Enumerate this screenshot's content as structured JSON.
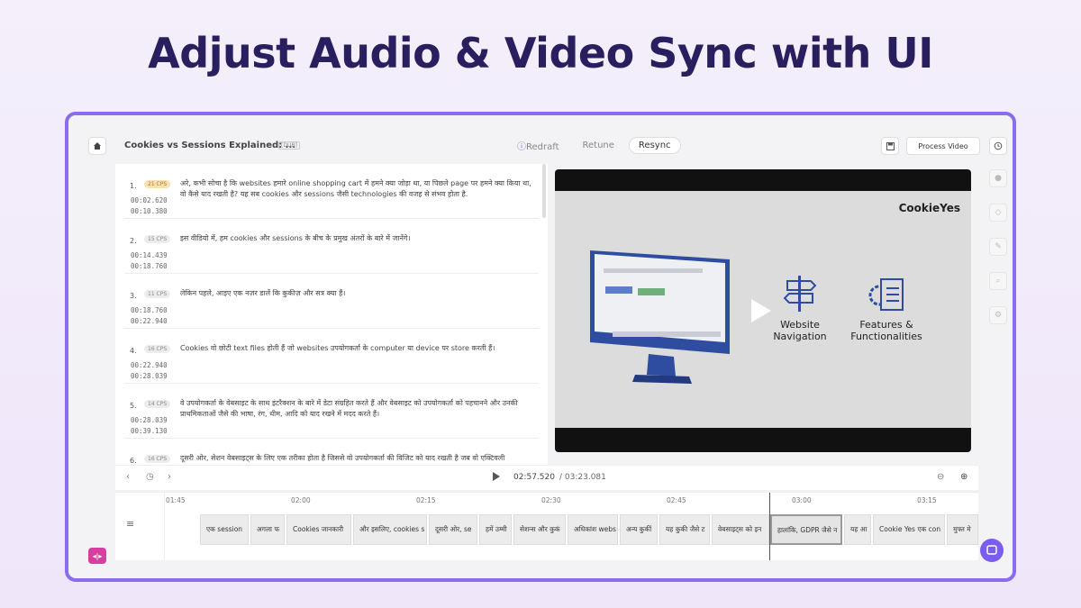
{
  "headline": "Adjust Audio & Video Sync with UI",
  "header": {
    "title": "Cookies vs Sessions Explained: ...",
    "badge": "[DUB]",
    "modes": [
      "Redraft",
      "Retune",
      "Resync"
    ],
    "active_mode": "Resync",
    "process_label": "Process Video"
  },
  "segments": [
    {
      "num": "1.",
      "cps": "21 CPS",
      "warn": true,
      "text": "अरे, कभी सोचा है कि websites हमारे online shopping cart में हमने क्या जोड़ा था, या पिछले page पर हमने क्या किया था, वो कैसे याद रखती है? यह सब cookies और sessions जैसी technologies की वजह से संभव होता है.",
      "start": "00:02.620",
      "end": "00:10.380"
    },
    {
      "num": "2.",
      "cps": "15 CPS",
      "warn": false,
      "text": "इस वीडियो में, हम cookies और sessions के बीच के प्रमुख अंतरों के बारे में जानेंगे।",
      "start": "00:14.439",
      "end": "00:18.760"
    },
    {
      "num": "3.",
      "cps": "11 CPS",
      "warn": false,
      "text": "लेकिन पहले, आइए एक नज़र डालें कि कुकीज़ और सत्र क्या हैं।",
      "start": "00:18.760",
      "end": "00:22.940"
    },
    {
      "num": "4.",
      "cps": "16 CPS",
      "warn": false,
      "text": "Cookies वो छोटी text files होती हैं जो websites उपयोगकर्ता के computer या device पर store करती हैं।",
      "start": "00:22.940",
      "end": "00:28.039"
    },
    {
      "num": "5.",
      "cps": "14 CPS",
      "warn": false,
      "text": "वे उपयोगकर्ता के वेबसाइट के साथ इंटरैक्शन के बारे में डेटा संग्रहित करते हैं और वेबसाइट को उपयोगकर्ता को पहचानने और उनकी प्राथमिकताओं जैसे की भाषा, रंग, थीम, आदि को याद रखने में मदद करते हैं।",
      "start": "00:28.039",
      "end": "00:39.130"
    },
    {
      "num": "6.",
      "cps": "16 CPS",
      "warn": false,
      "text": "दूसरी ओर, सेशन वेबसाइट्स के लिए एक तरीका होता है जिससे वो उपयोगकर्ता की विजिट को याद रखती है जब वो एक्टिवली",
      "start": "",
      "end": ""
    }
  ],
  "video": {
    "logo": "CookieYes",
    "caption1": "Website\nNavigation",
    "caption2": "Features &\nFunctionalities"
  },
  "player": {
    "current": "02:57.520",
    "total": "/ 03:23.081"
  },
  "timeline": {
    "ticks": [
      "01:45",
      "02:00",
      "02:15",
      "02:30",
      "02:45",
      "03:00",
      "03:15"
    ],
    "clips": [
      "एक session",
      "अगला फ",
      "Cookies जानकारी",
      "और इसलिए, cookies s",
      "दूसरी ओर, se",
      "हमें उम्मी",
      "सेशन्स और कुकं",
      "अधिकांश webs",
      "अन्य कुकीं",
      "यह कुकी जैसे ट",
      "वेबसाइट्स को इन",
      "हालांकि, GDPR जैसे न",
      "यह आ",
      "Cookie Yes एक con",
      "मुफ्त मे"
    ]
  }
}
